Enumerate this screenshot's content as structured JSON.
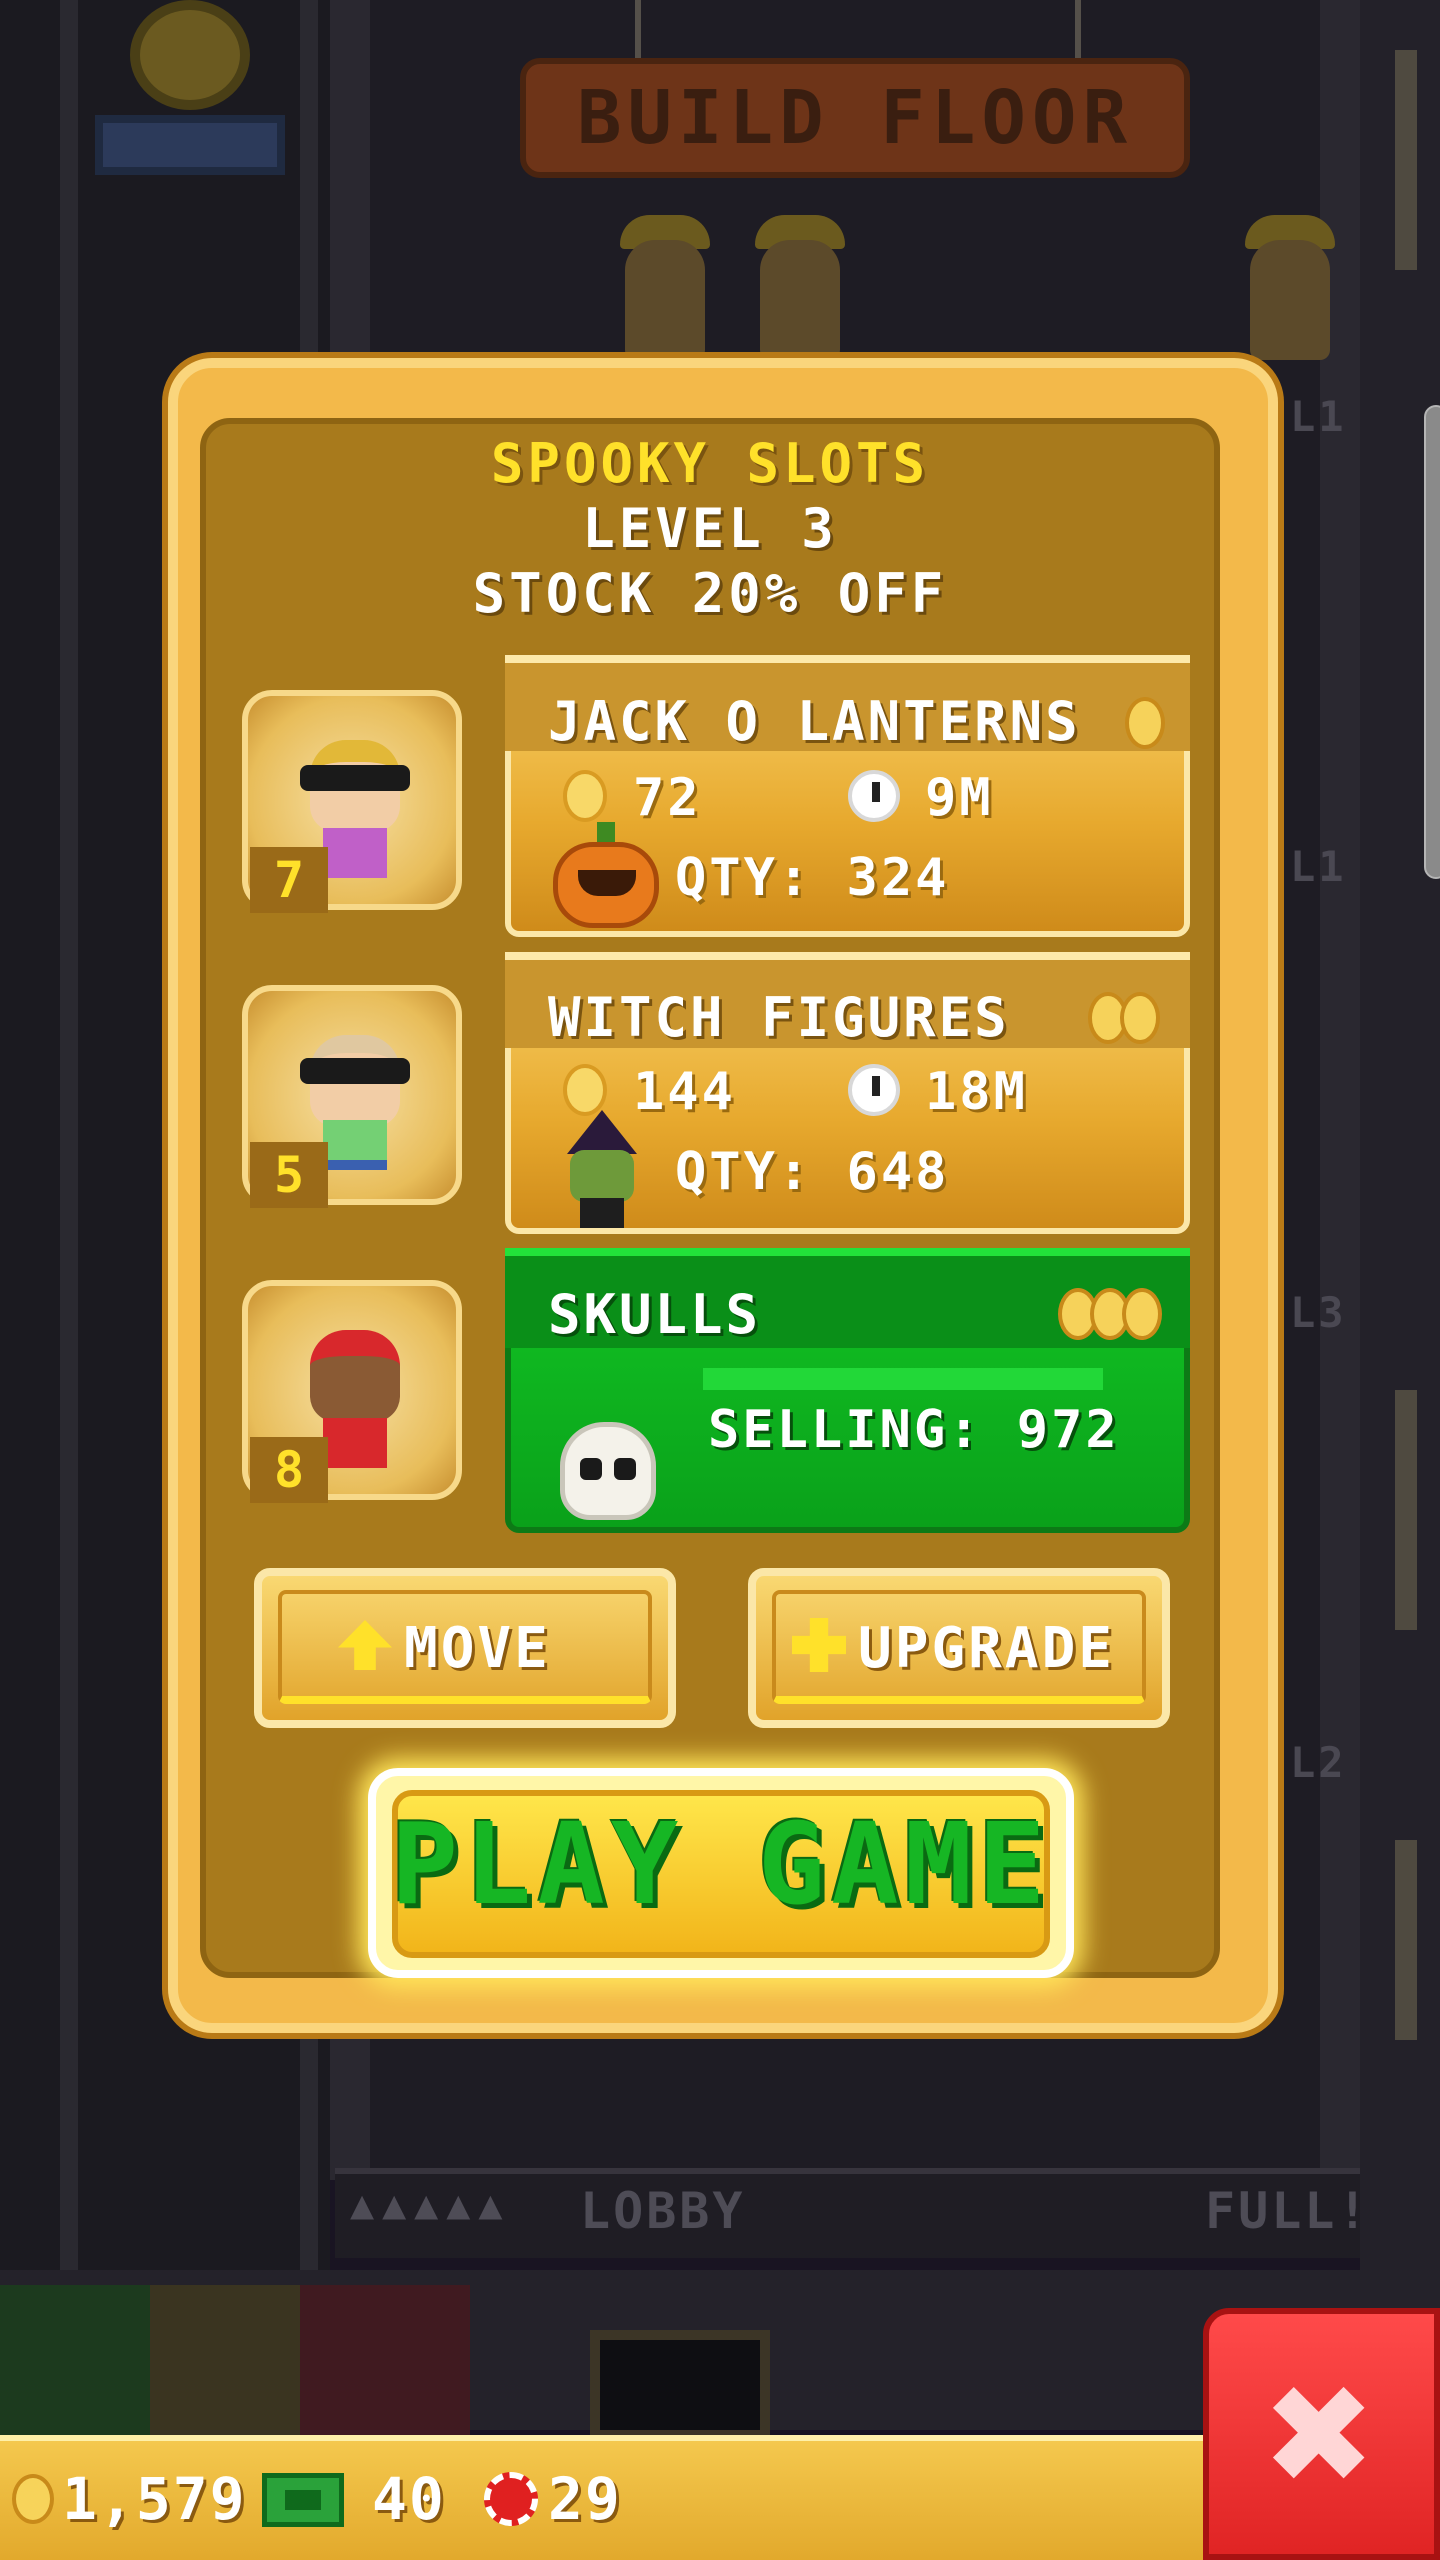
{
  "background": {
    "build_floor_sign": "BUILD FLOOR",
    "floor_labels": [
      "L1",
      "L1",
      "L3",
      "L2"
    ],
    "lobby_label": "LOBBY",
    "lobby_status": "FULL!",
    "lobby_dots": "▲▲▲▲▲"
  },
  "panel": {
    "title": "SPOOKY SLOTS",
    "level": "LEVEL 3",
    "discount": "STOCK 20% OFF"
  },
  "workers": [
    {
      "level": "7",
      "shirt": "#c060c8",
      "hair": "#e2b838"
    },
    {
      "level": "5",
      "shirt": "#74d074",
      "hair": "#e0c8a0"
    },
    {
      "level": "8",
      "shirt": "#d8282c",
      "hair": "#d8282c"
    }
  ],
  "stock": [
    {
      "name": "JACK O LANTERNS",
      "cost": "72",
      "time": "9M",
      "qty_label": "QTY: 324",
      "tier_coins": 1
    },
    {
      "name": "WITCH FIGURES",
      "cost": "144",
      "time": "18M",
      "qty_label": "QTY: 648",
      "tier_coins": 2
    },
    {
      "name": "SKULLS",
      "status": "SELLING: 972",
      "tier_coins": 3,
      "progress": 1.0
    }
  ],
  "actions": {
    "move": "MOVE",
    "upgrade": "UPGRADE",
    "play": "PLAY GAME"
  },
  "currency": {
    "coins": "1,579",
    "bux": "40",
    "chips": "29"
  },
  "close_label": "✖",
  "colors": {
    "panel": "#f3b94a",
    "title_yellow": "#ffe12a",
    "selling_green": "#0aa11a",
    "close_red": "#e02424"
  }
}
